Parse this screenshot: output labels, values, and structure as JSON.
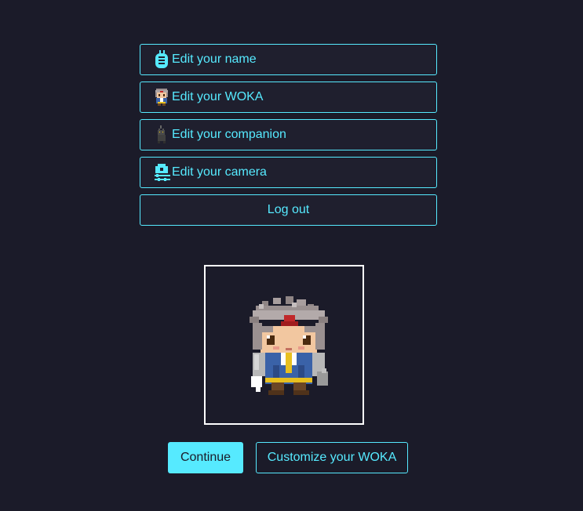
{
  "menu": {
    "items": [
      {
        "label": "Edit your name",
        "icon": "name-tag-icon"
      },
      {
        "label": "Edit your WOKA",
        "icon": "woka-avatar-icon"
      },
      {
        "label": "Edit your companion",
        "icon": "companion-cat-icon"
      },
      {
        "label": "Edit your camera",
        "icon": "camera-settings-icon"
      }
    ],
    "logout_label": "Log out"
  },
  "preview": {
    "avatar": "woka-character"
  },
  "actions": {
    "continue_label": "Continue",
    "customize_label": "Customize your WOKA"
  },
  "colors": {
    "background": "#1b1b29",
    "accent": "#56eaff",
    "frame": "#ffffff"
  }
}
